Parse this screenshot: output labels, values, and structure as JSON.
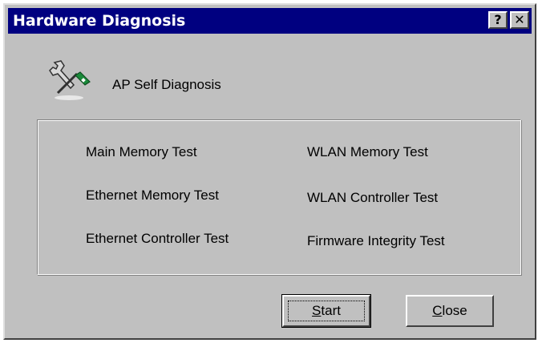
{
  "window": {
    "title": "Hardware Diagnosis",
    "help_button": "?",
    "close_button": "✕"
  },
  "header": {
    "label": "AP Self Diagnosis",
    "icon": "tools-icon"
  },
  "tests": {
    "left": [
      "Main Memory Test",
      "Ethernet Memory Test",
      "Ethernet Controller Test"
    ],
    "right": [
      "WLAN Memory Test",
      "WLAN Controller Test",
      "Firmware Integrity Test"
    ]
  },
  "buttons": {
    "start": {
      "mnemonic": "S",
      "rest": "tart"
    },
    "close": {
      "mnemonic": "C",
      "rest": "lose"
    }
  },
  "colors": {
    "titlebar": "#000080",
    "face": "#c0c0c0",
    "icon_green": "#1a8a3a"
  }
}
